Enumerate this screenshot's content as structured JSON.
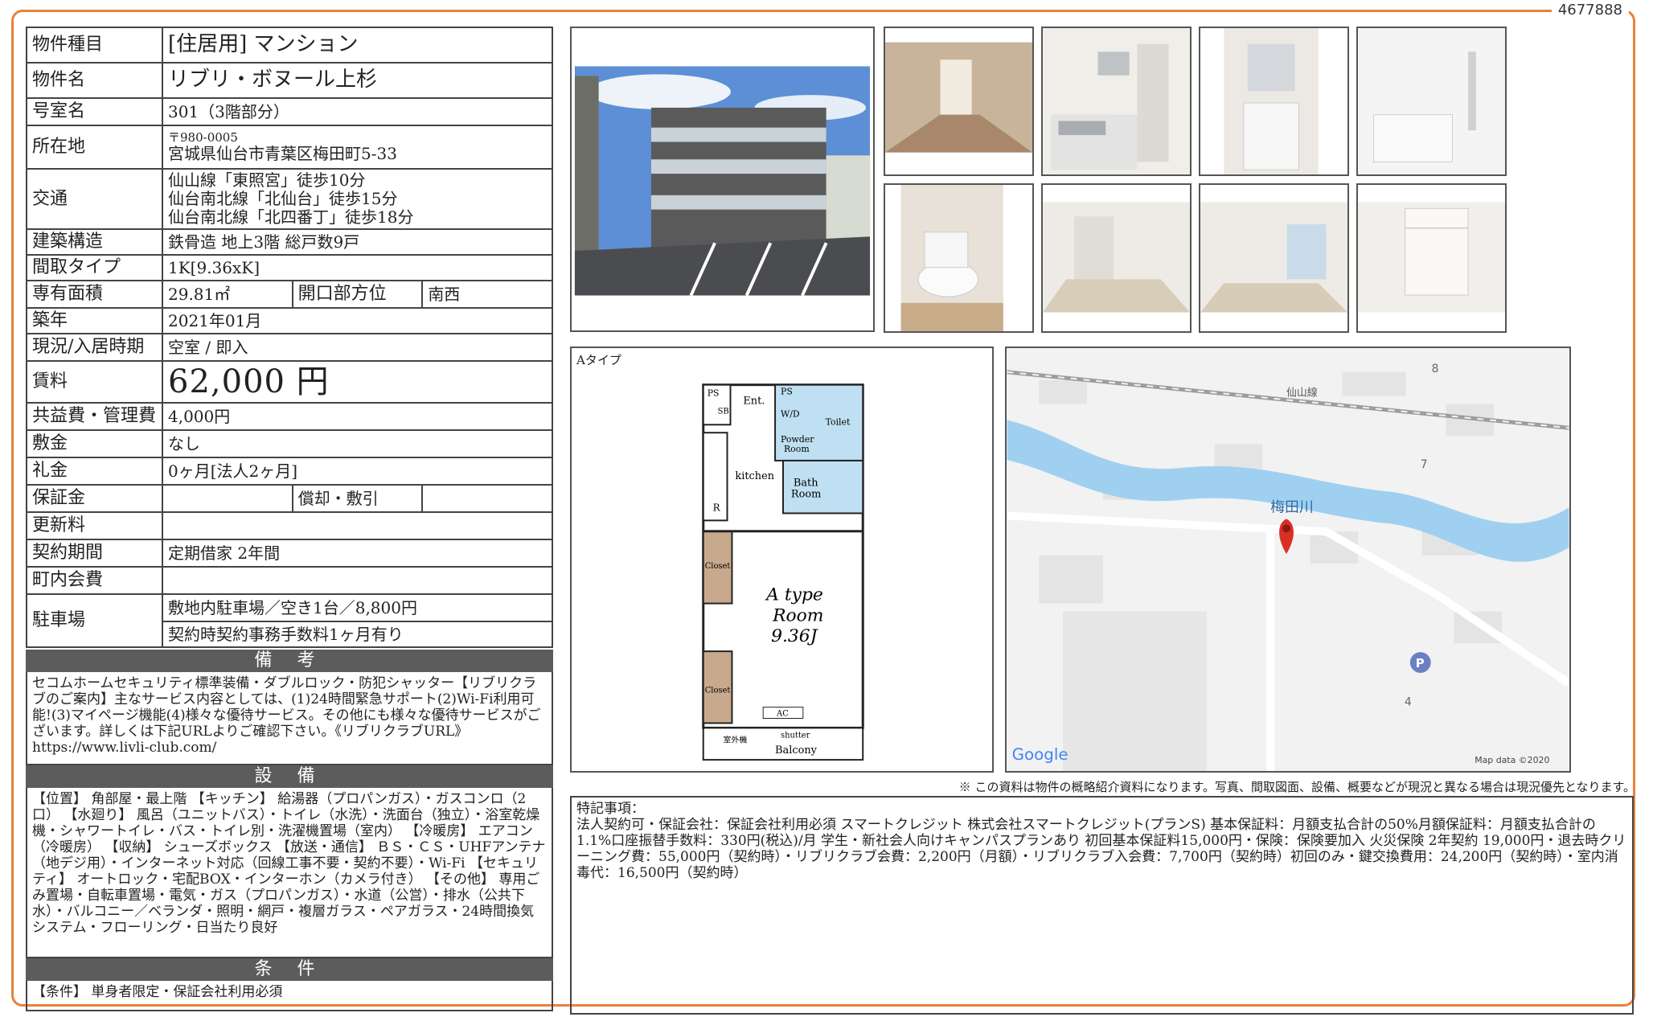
{
  "doc_id": "4677888",
  "property": {
    "type_label": "物件種目",
    "type_value": "[住居用] マンション",
    "name_label": "物件名",
    "name_value": "リブリ・ボヌール上杉",
    "room_label": "号室名",
    "room_value": "301（3階部分）",
    "address_label": "所在地",
    "postal": "〒980-0005",
    "address": "宮城県仙台市青葉区梅田町5-33",
    "transport_label": "交通",
    "transport": [
      "仙山線「東照宮」徒歩10分",
      "仙台南北線「北仙台」徒歩15分",
      "仙台南北線「北四番丁」徒歩18分"
    ],
    "structure_label": "建築構造",
    "structure_value": "鉄骨造 地上3階 総戸数9戸",
    "layout_label": "間取タイプ",
    "layout_value": "1K[9.36xK]",
    "area_label": "専有面積",
    "area_value": "29.81㎡",
    "direction_label": "開口部方位",
    "direction_value": "南西",
    "built_label": "築年",
    "built_value": "2021年01月",
    "status_label": "現況/入居時期",
    "status_value": "空室 / 即入",
    "rent_label": "賃料",
    "rent_value": "62,000 円",
    "fee_label": "共益費・管理費",
    "fee_value": "4,000円",
    "deposit_label": "敷金",
    "deposit_value": "なし",
    "keymoney_label": "礼金",
    "keymoney_value": "0ヶ月[法人2ヶ月]",
    "guarantee_label": "保証金",
    "guarantee_value": "",
    "amort_label": "償却・敷引",
    "amort_value": "",
    "renewal_label": "更新料",
    "renewal_value": "",
    "contract_label": "契約期間",
    "contract_value": "定期借家 2年間",
    "town_label": "町内会費",
    "town_value": "",
    "parking_label": "駐車場",
    "parking_value1": "敷地内駐車場／空き1台／8,800円",
    "parking_value2": "契約時契約事務手数料1ヶ月有り"
  },
  "remarks": {
    "title": "備 考",
    "text": "セコムホームセキュリティ標準装備・ダブルロック・防犯シャッター【リブリクラブのご案内】主なサービス内容としては、(1)24時間緊急サポート(2)Wi-Fi利用可能!(3)マイページ機能(4)様々な優待サービス。その他にも様々な優待サービスがございます。詳しくは下記URLよりご確認下さい。《リブリクラブURL》https://www.livli-club.com/"
  },
  "equipment": {
    "title": "設 備",
    "text": "【位置】 角部屋・最上階 【キッチン】 給湯器（プロパンガス）・ガスコンロ（2口） 【水廻り】 風呂（ユニットバス）・トイレ（水洗）・洗面台（独立）・浴室乾燥機・シャワートイレ・バス・トイレ別・洗濯機置場（室内） 【冷暖房】 エアコン（冷暖房） 【収納】 シューズボックス 【放送・通信】 ＢＳ・ＣＳ・UHFアンテナ（地デジ用）・インターネット対応（回線工事不要・契約不要）・Wi-Fi 【セキュリティ】 オートロック・宅配BOX・インターホン（カメラ付き） 【その他】 専用ごみ置場・自転車置場・電気・ガス（プロパンガス）・水道（公営）・排水（公共下水）・バルコニー／ベランダ・照明・網戸・複層ガラス・ペアガラス・24時間換気システム・フローリング・日当たり良好"
  },
  "conditions": {
    "title": "条 件",
    "text": "【条件】 単身者限定・保証会社利用必須"
  },
  "floorplan": {
    "type_label": "Aタイプ",
    "room_name": "A type",
    "room_word": "Room",
    "room_size": "9.36J",
    "labels": {
      "ps1": "PS",
      "sb": "SB",
      "ent": "Ent.",
      "ps2": "PS",
      "wd": "W/D",
      "toilet": "Toilet",
      "powder1": "Powder",
      "powder2": "Room",
      "kitchen": "kitchen",
      "bath1": "Bath",
      "bath2": "Room",
      "r": "R",
      "closet1": "Closet",
      "closet2": "Closet",
      "ac": "AC",
      "outdoor": "室外機",
      "shutter": "shutter",
      "balcony": "Balcony"
    }
  },
  "map": {
    "river": "梅田川",
    "rail": "仙山線",
    "num8": "8",
    "num7": "7",
    "num4": "4",
    "parking_marker": "P",
    "google": "Google",
    "mapdata": "Map data ©2020",
    "river_color": "#9fd0f0",
    "pin_color": "#d93025"
  },
  "disclaimer": "※ この資料は物件の概略紹介資料になります。写真、間取図面、設備、概要などが現況と異なる場合は現況優先となります。",
  "special": {
    "title": "特記事項：",
    "text": "法人契約可・保証会社：保証会社利用必須 スマートクレジット 株式会社スマートクレジット(プランS) 基本保証料：月額支払合計の50%月額保証料：月額支払合計の1.1%口座振替手数料：330円(税込)/月 学生・新社会人向けキャンパスプランあり 初回基本保証料15,000円・保険：保険要加入 火災保険 2年契約 19,000円・退去時クリーニング費：55,000円（契約時）・リブリクラブ会費：2,200円（月額）・リブリクラブ入会費：7,700円（契約時）初回のみ・鍵交換費用：24,200円（契約時）・室内消毒代：16,500円（契約時）"
  }
}
